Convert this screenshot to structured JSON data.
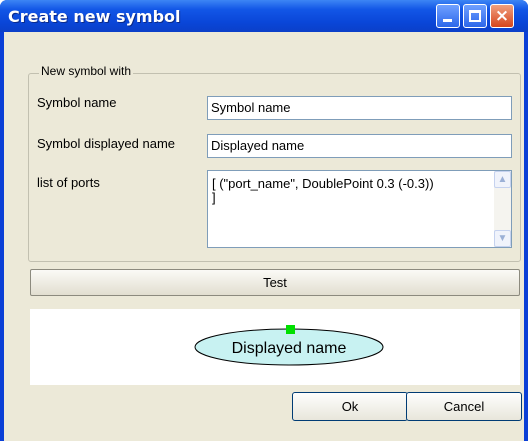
{
  "window": {
    "title": "Create new symbol"
  },
  "groupbox": {
    "legend": "New symbol with",
    "symbol_name_label": "Symbol name",
    "symbol_name_value": "Symbol name",
    "displayed_name_label": "Symbol displayed name",
    "displayed_name_value": "Displayed name",
    "ports_label": "list of ports",
    "ports_line1": "[ (\"port_name\", DoublePoint 0.3 (-0.3))",
    "ports_line2": "]"
  },
  "buttons": {
    "test": "Test",
    "ok": "Ok",
    "cancel": "Cancel"
  },
  "preview": {
    "symbol_text": "Displayed name",
    "ellipse_fill": "#c8f2f2",
    "port_color": "#00e000"
  },
  "icons": {
    "close": "×"
  }
}
